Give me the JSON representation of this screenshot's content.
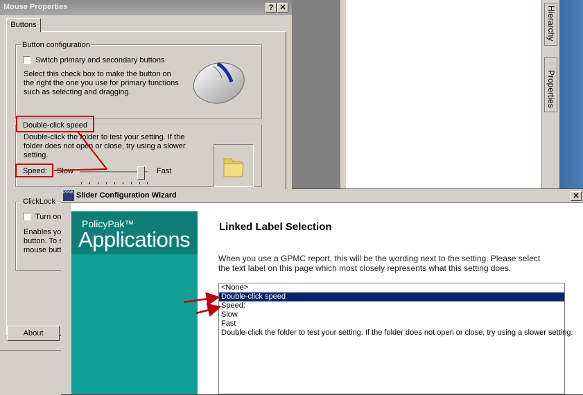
{
  "mouse_dialog": {
    "title": "Mouse Properties",
    "help_btn": "?",
    "close_btn": "✕",
    "tab": "Buttons",
    "button_config": {
      "group_label": "Button configuration",
      "switch_label": "Switch primary and secondary buttons",
      "desc_lines": [
        "Select this check box to make the button on",
        "the right the one you use for primary functions",
        "such as selecting and dragging."
      ]
    },
    "double_click": {
      "group_label": "Double-click speed",
      "desc_lines": [
        "Double-click the folder to test your setting. If the",
        "folder does not open or close, try using a slower",
        "setting."
      ],
      "speed_label": "Speed:",
      "slow": "Slow",
      "fast": "Fast",
      "value_fraction": 0.95
    },
    "clicklock": {
      "group_label": "ClickLock",
      "turn_on": "Turn on",
      "desc_lines": [
        "Enables yo",
        "button. To s",
        "mouse butt"
      ]
    },
    "about_button": "About"
  },
  "side_tabs": [
    "Hierarchy",
    "Properties"
  ],
  "wizard": {
    "title": "Slider Configuration Wizard",
    "icon_text": "PPAK",
    "close_btn": "✕",
    "brand_small": "PolicyPak™",
    "brand_big": "Applications",
    "heading": "Linked Label Selection",
    "desc_lines": [
      "When you use a GPMC report, this will be the wording next to the setting. Please select",
      "the text label on this page which most closely represents what this setting does."
    ],
    "list_items": [
      "<None>",
      "Double-click speed",
      "Speed:",
      "Slow",
      "Fast",
      "Double-click the folder to test your setting. If the folder does not open or close, try using a slower setting."
    ],
    "selected_index": 1
  },
  "colors": {
    "annotation_red": "#c00000",
    "selection": "#0a246a",
    "brand_teal": "#0f9f95"
  }
}
